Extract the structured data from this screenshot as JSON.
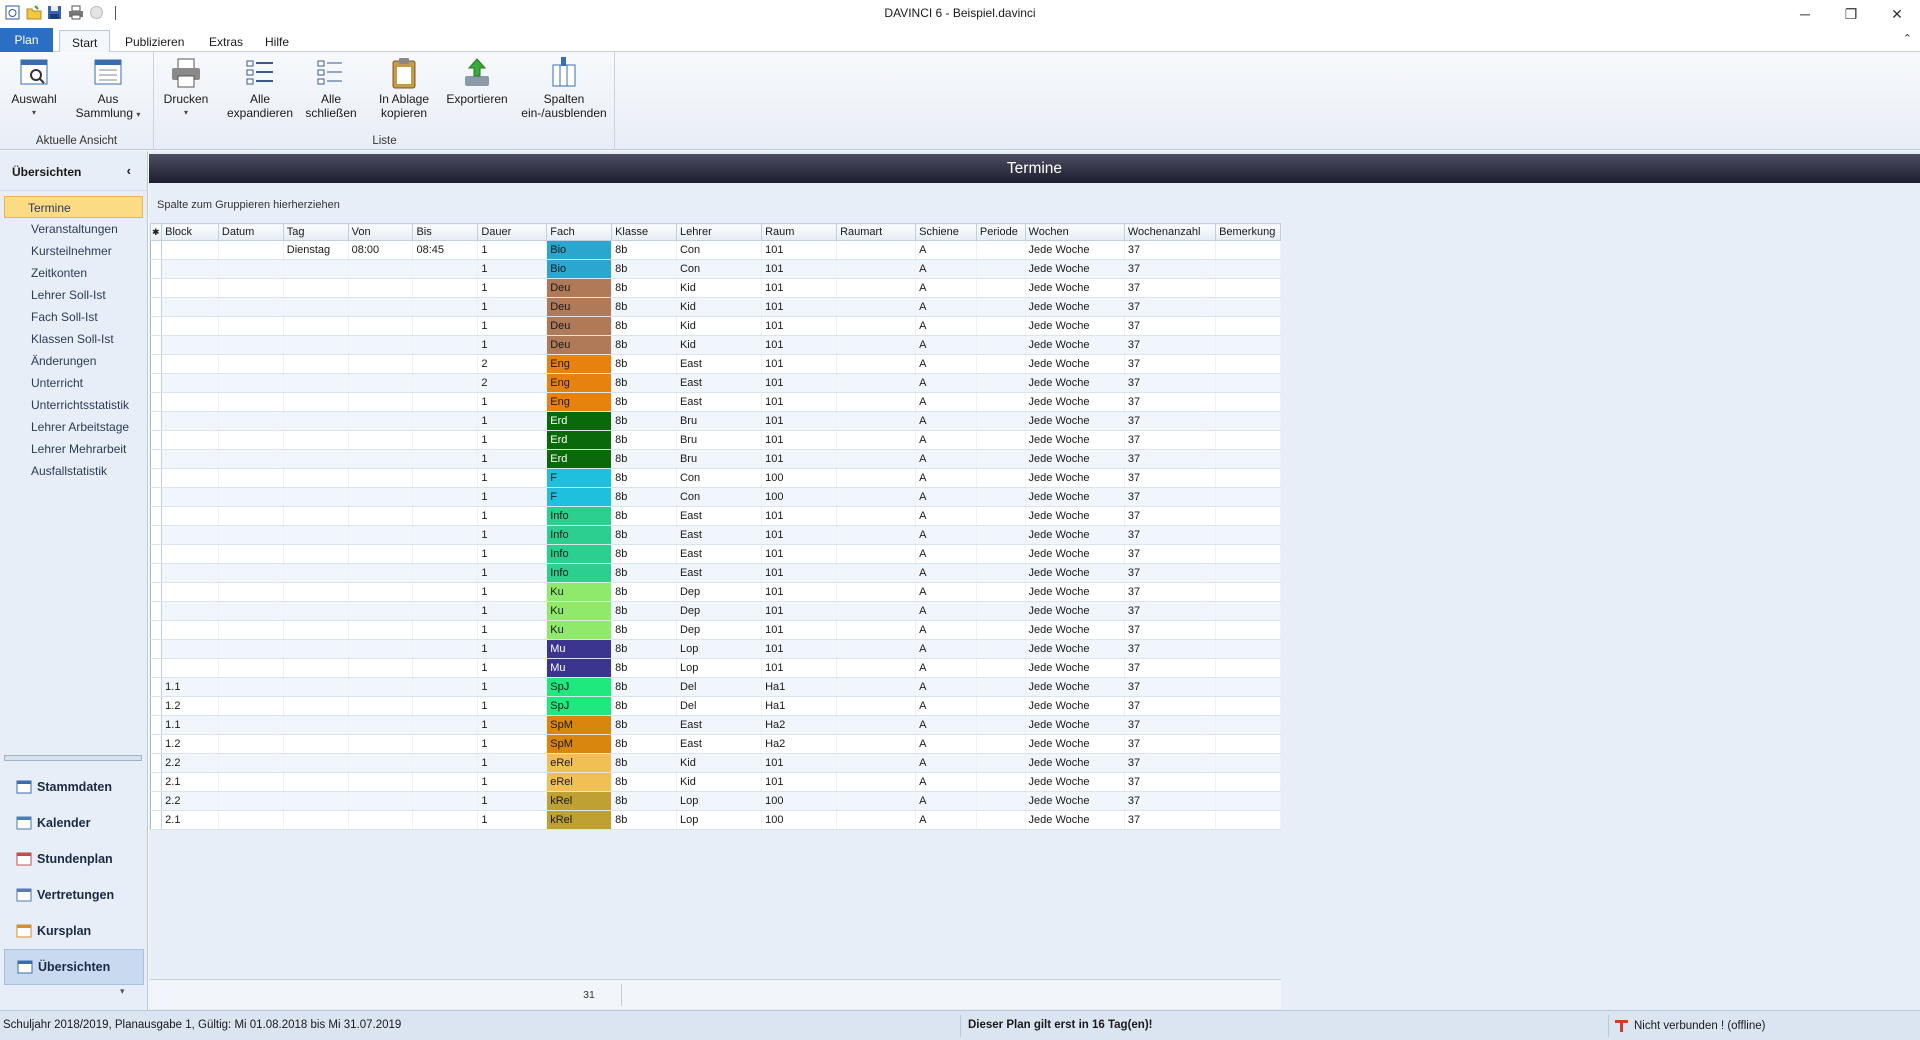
{
  "window": {
    "title": "DAVINCI 6 - Beispiel.davinci",
    "minimize": "─",
    "restore": "❐",
    "close": "✕"
  },
  "ribbon": {
    "tabs": [
      "Plan",
      "Start",
      "Publizieren",
      "Extras",
      "Hilfe"
    ],
    "collapse_glyph": "⌃",
    "group1": {
      "label": "Aktuelle Ansicht",
      "buttons": [
        {
          "label": "Auswahl",
          "icon": "view-select-icon"
        },
        {
          "label1": "Aus",
          "label2": "Sammlung",
          "icon": "collection-icon"
        }
      ]
    },
    "group2": {
      "label": "Liste",
      "buttons": [
        {
          "label": "Drucken",
          "icon": "printer-icon"
        },
        {
          "label1": "Alle",
          "label2": "expandieren",
          "icon": "expand-all-icon"
        },
        {
          "label1": "Alle",
          "label2": "schließen",
          "icon": "collapse-all-icon"
        },
        {
          "label1": "In Ablage",
          "label2": "kopieren",
          "icon": "clipboard-icon"
        },
        {
          "label": "Exportieren",
          "icon": "export-icon"
        },
        {
          "label1": "Spalten",
          "label2": "ein-/ausblenden",
          "icon": "columns-icon"
        }
      ]
    }
  },
  "sidebar": {
    "title": "Übersichten",
    "collapse_glyph": "‹",
    "items": [
      "Termine",
      "Veranstaltungen",
      "Kursteilnehmer",
      "Zeitkonten",
      "Lehrer Soll-Ist",
      "Fach Soll-Ist",
      "Klassen Soll-Ist",
      "Änderungen",
      "Unterricht",
      "Unterrichtsstatistik",
      "Lehrer Arbeitstage",
      "Lehrer Mehrarbeit",
      "Ausfallstatistik"
    ],
    "active_item": "Termine",
    "nav": [
      "Stammdaten",
      "Kalender",
      "Stundenplan",
      "Vertretungen",
      "Kursplan",
      "Übersichten"
    ],
    "more_glyph": "▾"
  },
  "main": {
    "header": "Termine",
    "group_hint": "Spalte zum Gruppieren hierherziehen",
    "columns": [
      "✱",
      "Block",
      "Datum",
      "Tag",
      "Von",
      "Bis",
      "Dauer",
      "Fach",
      "Klasse",
      "Lehrer",
      "Raum",
      "Raumart",
      "Schiene",
      "Periode",
      "Wochen",
      "Wochenanzahl",
      "Bemerkung"
    ],
    "rows": [
      {
        "block": "",
        "tag": "Dienstag",
        "von": "08:00",
        "bis": "08:45",
        "dauer": "1",
        "fach": "Bio",
        "color": "#2aa6cf",
        "klasse": "8b",
        "lehrer": "Con",
        "raum": "101"
      },
      {
        "block": "",
        "tag": "",
        "von": "",
        "bis": "",
        "dauer": "1",
        "fach": "Bio",
        "color": "#2aa6cf",
        "klasse": "8b",
        "lehrer": "Con",
        "raum": "101"
      },
      {
        "block": "",
        "tag": "",
        "von": "",
        "bis": "",
        "dauer": "1",
        "fach": "Deu",
        "color": "#b07a58",
        "klasse": "8b",
        "lehrer": "Kid",
        "raum": "101"
      },
      {
        "block": "",
        "tag": "",
        "von": "",
        "bis": "",
        "dauer": "1",
        "fach": "Deu",
        "color": "#b07a58",
        "klasse": "8b",
        "lehrer": "Kid",
        "raum": "101"
      },
      {
        "block": "",
        "tag": "",
        "von": "",
        "bis": "",
        "dauer": "1",
        "fach": "Deu",
        "color": "#b07a58",
        "klasse": "8b",
        "lehrer": "Kid",
        "raum": "101"
      },
      {
        "block": "",
        "tag": "",
        "von": "",
        "bis": "",
        "dauer": "1",
        "fach": "Deu",
        "color": "#b07a58",
        "klasse": "8b",
        "lehrer": "Kid",
        "raum": "101"
      },
      {
        "block": "",
        "tag": "",
        "von": "",
        "bis": "",
        "dauer": "2",
        "fach": "Eng",
        "color": "#e8820f",
        "klasse": "8b",
        "lehrer": "East",
        "raum": "101"
      },
      {
        "block": "",
        "tag": "",
        "von": "",
        "bis": "",
        "dauer": "2",
        "fach": "Eng",
        "color": "#e8820f",
        "klasse": "8b",
        "lehrer": "East",
        "raum": "101"
      },
      {
        "block": "",
        "tag": "",
        "von": "",
        "bis": "",
        "dauer": "1",
        "fach": "Eng",
        "color": "#e8820f",
        "klasse": "8b",
        "lehrer": "East",
        "raum": "101"
      },
      {
        "block": "",
        "tag": "",
        "von": "",
        "bis": "",
        "dauer": "1",
        "fach": "Erd",
        "color": "#0a6a0a",
        "klasse": "8b",
        "lehrer": "Bru",
        "raum": "101",
        "light": true
      },
      {
        "block": "",
        "tag": "",
        "von": "",
        "bis": "",
        "dauer": "1",
        "fach": "Erd",
        "color": "#0a6a0a",
        "klasse": "8b",
        "lehrer": "Bru",
        "raum": "101",
        "light": true
      },
      {
        "block": "",
        "tag": "",
        "von": "",
        "bis": "",
        "dauer": "1",
        "fach": "Erd",
        "color": "#0a6a0a",
        "klasse": "8b",
        "lehrer": "Bru",
        "raum": "101",
        "light": true
      },
      {
        "block": "",
        "tag": "",
        "von": "",
        "bis": "",
        "dauer": "1",
        "fach": "F",
        "color": "#1ec0de",
        "klasse": "8b",
        "lehrer": "Con",
        "raum": "100"
      },
      {
        "block": "",
        "tag": "",
        "von": "",
        "bis": "",
        "dauer": "1",
        "fach": "F",
        "color": "#1ec0de",
        "klasse": "8b",
        "lehrer": "Con",
        "raum": "100"
      },
      {
        "block": "",
        "tag": "",
        "von": "",
        "bis": "",
        "dauer": "1",
        "fach": "Info",
        "color": "#2ccf8e",
        "klasse": "8b",
        "lehrer": "East",
        "raum": "101"
      },
      {
        "block": "",
        "tag": "",
        "von": "",
        "bis": "",
        "dauer": "1",
        "fach": "Info",
        "color": "#2ccf8e",
        "klasse": "8b",
        "lehrer": "East",
        "raum": "101"
      },
      {
        "block": "",
        "tag": "",
        "von": "",
        "bis": "",
        "dauer": "1",
        "fach": "Info",
        "color": "#2ccf8e",
        "klasse": "8b",
        "lehrer": "East",
        "raum": "101"
      },
      {
        "block": "",
        "tag": "",
        "von": "",
        "bis": "",
        "dauer": "1",
        "fach": "Info",
        "color": "#2ccf8e",
        "klasse": "8b",
        "lehrer": "East",
        "raum": "101"
      },
      {
        "block": "",
        "tag": "",
        "von": "",
        "bis": "",
        "dauer": "1",
        "fach": "Ku",
        "color": "#8fe96a",
        "klasse": "8b",
        "lehrer": "Dep",
        "raum": "101"
      },
      {
        "block": "",
        "tag": "",
        "von": "",
        "bis": "",
        "dauer": "1",
        "fach": "Ku",
        "color": "#8fe96a",
        "klasse": "8b",
        "lehrer": "Dep",
        "raum": "101"
      },
      {
        "block": "",
        "tag": "",
        "von": "",
        "bis": "",
        "dauer": "1",
        "fach": "Ku",
        "color": "#8fe96a",
        "klasse": "8b",
        "lehrer": "Dep",
        "raum": "101"
      },
      {
        "block": "",
        "tag": "",
        "von": "",
        "bis": "",
        "dauer": "1",
        "fach": "Mu",
        "color": "#3c3590",
        "klasse": "8b",
        "lehrer": "Lop",
        "raum": "101",
        "light": true
      },
      {
        "block": "",
        "tag": "",
        "von": "",
        "bis": "",
        "dauer": "1",
        "fach": "Mu",
        "color": "#3c3590",
        "klasse": "8b",
        "lehrer": "Lop",
        "raum": "101",
        "light": true
      },
      {
        "block": "1.1",
        "tag": "",
        "von": "",
        "bis": "",
        "dauer": "1",
        "fach": "SpJ",
        "color": "#1ee87e",
        "klasse": "8b",
        "lehrer": "Del",
        "raum": "Ha1"
      },
      {
        "block": "1.2",
        "tag": "",
        "von": "",
        "bis": "",
        "dauer": "1",
        "fach": "SpJ",
        "color": "#1ee87e",
        "klasse": "8b",
        "lehrer": "Del",
        "raum": "Ha1"
      },
      {
        "block": "1.1",
        "tag": "",
        "von": "",
        "bis": "",
        "dauer": "1",
        "fach": "SpM",
        "color": "#d8860e",
        "klasse": "8b",
        "lehrer": "East",
        "raum": "Ha2"
      },
      {
        "block": "1.2",
        "tag": "",
        "von": "",
        "bis": "",
        "dauer": "1",
        "fach": "SpM",
        "color": "#d8860e",
        "klasse": "8b",
        "lehrer": "East",
        "raum": "Ha2"
      },
      {
        "block": "2.2",
        "tag": "",
        "von": "",
        "bis": "",
        "dauer": "1",
        "fach": "eRel",
        "color": "#f0c054",
        "klasse": "8b",
        "lehrer": "Kid",
        "raum": "101"
      },
      {
        "block": "2.1",
        "tag": "",
        "von": "",
        "bis": "",
        "dauer": "1",
        "fach": "eRel",
        "color": "#f0c054",
        "klasse": "8b",
        "lehrer": "Kid",
        "raum": "101"
      },
      {
        "block": "2.2",
        "tag": "",
        "von": "",
        "bis": "",
        "dauer": "1",
        "fach": "kRel",
        "color": "#bfa133",
        "klasse": "8b",
        "lehrer": "Lop",
        "raum": "100"
      },
      {
        "block": "2.1",
        "tag": "",
        "von": "",
        "bis": "",
        "dauer": "1",
        "fach": "kRel",
        "color": "#bfa133",
        "klasse": "8b",
        "lehrer": "Lop",
        "raum": "100"
      }
    ],
    "row_defaults": {
      "schiene": "A",
      "wochen": "Jede Woche",
      "wochenanzahl": "37"
    },
    "count": "31"
  },
  "statusbar": {
    "left": "Schuljahr 2018/2019, Planausgabe 1, Gültig: Mi 01.08.2018 bis Mi 31.07.2019",
    "middle": "Dieser Plan gilt erst in 16 Tag(en)!",
    "right": "Nicht verbunden ! (offline)"
  }
}
